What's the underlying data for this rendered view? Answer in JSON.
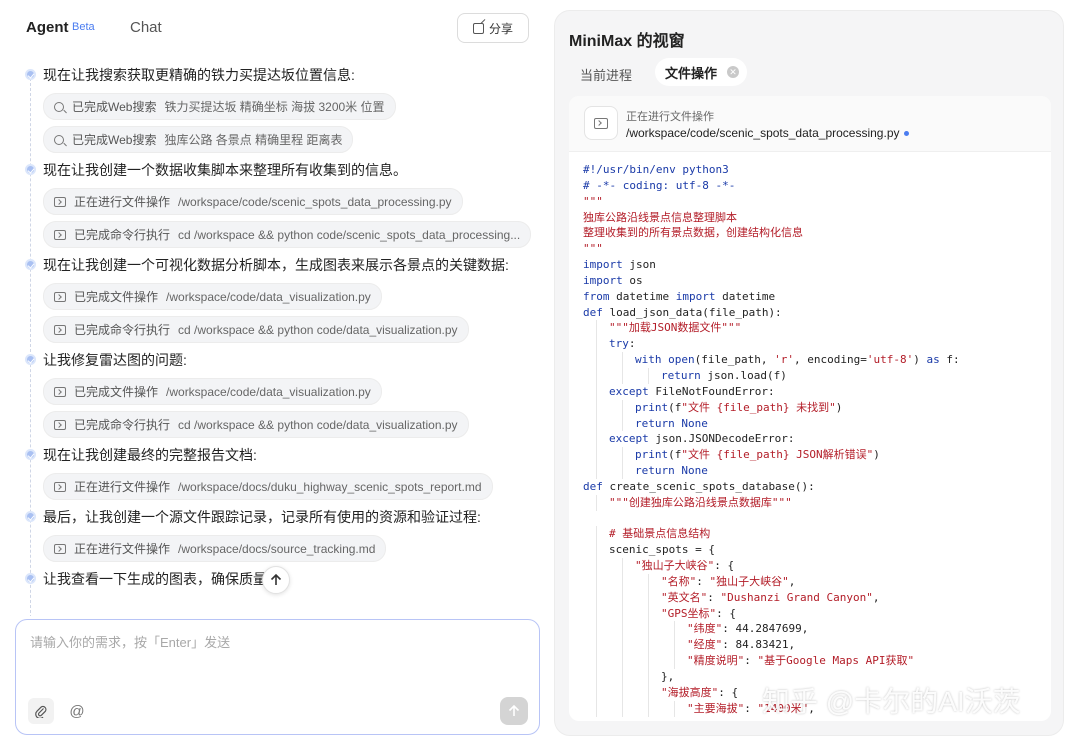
{
  "header": {
    "agent_tab": "Agent",
    "beta_badge": "Beta",
    "chat_tab": "Chat",
    "share_label": "分享"
  },
  "steps": [
    {
      "title": "现在让我搜索获取更精确的铁力买提达坂位置信息:",
      "chips": [
        {
          "icon": "search-icon",
          "status": "已完成Web搜索",
          "detail": "铁力买提达坂 精确坐标 海拔 3200米 位置"
        },
        {
          "icon": "search-icon",
          "status": "已完成Web搜索",
          "detail": "独库公路 各景点 精确里程 距离表"
        }
      ]
    },
    {
      "title": "现在让我创建一个数据收集脚本来整理所有收集到的信息。",
      "chips": [
        {
          "icon": "terminal-icon",
          "status": "正在进行文件操作",
          "detail": "/workspace/code/scenic_spots_data_processing.py"
        },
        {
          "icon": "terminal-icon",
          "status": "已完成命令行执行",
          "detail": "cd /workspace && python code/scenic_spots_data_processing..."
        }
      ]
    },
    {
      "title": "现在让我创建一个可视化数据分析脚本，生成图表来展示各景点的关键数据:",
      "chips": [
        {
          "icon": "terminal-icon",
          "status": "已完成文件操作",
          "detail": "/workspace/code/data_visualization.py"
        },
        {
          "icon": "terminal-icon",
          "status": "已完成命令行执行",
          "detail": "cd /workspace && python code/data_visualization.py"
        }
      ]
    },
    {
      "title": "让我修复雷达图的问题:",
      "chips": [
        {
          "icon": "terminal-icon",
          "status": "已完成文件操作",
          "detail": "/workspace/code/data_visualization.py"
        },
        {
          "icon": "terminal-icon",
          "status": "已完成命令行执行",
          "detail": "cd /workspace && python code/data_visualization.py"
        }
      ]
    },
    {
      "title": "现在让我创建最终的完整报告文档:",
      "chips": [
        {
          "icon": "terminal-icon",
          "status": "正在进行文件操作",
          "detail": "/workspace/docs/duku_highway_scenic_spots_report.md"
        }
      ]
    },
    {
      "title": "最后，让我创建一个源文件跟踪记录，记录所有使用的资源和验证过程:",
      "chips": [
        {
          "icon": "terminal-icon",
          "status": "正在进行文件操作",
          "detail": "/workspace/docs/source_tracking.md"
        }
      ]
    },
    {
      "title": "让我查看一下生成的图表，确保质量:",
      "chips": []
    }
  ],
  "input": {
    "placeholder": "请输入你的需求，按「Enter」发送",
    "value": ""
  },
  "right_panel": {
    "title": "MiniMax 的视窗",
    "tabs": [
      "当前进程",
      "文件操作"
    ],
    "active_tab": "文件操作",
    "file_status": "正在进行文件操作",
    "file_path": "/workspace/code/scenic_spots_data_processing.py",
    "code_lines": [
      {
        "indent": 0,
        "text": "#!/usr/bin/env python3"
      },
      {
        "indent": 0,
        "text": "# -*- coding: utf-8 -*-"
      },
      {
        "indent": 0,
        "text": "\"\"\""
      },
      {
        "indent": 0,
        "text": "独库公路沿线景点信息整理脚本"
      },
      {
        "indent": 0,
        "text": "整理收集到的所有景点数据，创建结构化信息"
      },
      {
        "indent": 0,
        "text": "\"\"\""
      },
      {
        "indent": 0,
        "text": "import json"
      },
      {
        "indent": 0,
        "text": "import os"
      },
      {
        "indent": 0,
        "text": "from datetime import datetime"
      },
      {
        "indent": 0,
        "text": "def load_json_data(file_path):"
      },
      {
        "indent": 1,
        "text": "\"\"\"加载JSON数据文件\"\"\""
      },
      {
        "indent": 1,
        "text": "try:"
      },
      {
        "indent": 2,
        "text": "with open(file_path, 'r', encoding='utf-8') as f:"
      },
      {
        "indent": 3,
        "text": "return json.load(f)"
      },
      {
        "indent": 1,
        "text": "except FileNotFoundError:"
      },
      {
        "indent": 2,
        "text": "print(f\"文件 {file_path} 未找到\")"
      },
      {
        "indent": 2,
        "text": "return None"
      },
      {
        "indent": 1,
        "text": "except json.JSONDecodeError:"
      },
      {
        "indent": 2,
        "text": "print(f\"文件 {file_path} JSON解析错误\")"
      },
      {
        "indent": 2,
        "text": "return None"
      },
      {
        "indent": 0,
        "text": "def create_scenic_spots_database():"
      },
      {
        "indent": 1,
        "text": "\"\"\"创建独库公路沿线景点数据库\"\"\""
      },
      {
        "indent": 0,
        "text": ""
      },
      {
        "indent": 1,
        "text": "# 基础景点信息结构"
      },
      {
        "indent": 1,
        "text": "scenic_spots = {"
      },
      {
        "indent": 2,
        "text": "\"独山子大峡谷\": {"
      },
      {
        "indent": 3,
        "text": "\"名称\": \"独山子大峡谷\","
      },
      {
        "indent": 3,
        "text": "\"英文名\": \"Dushanzi Grand Canyon\","
      },
      {
        "indent": 3,
        "text": "\"GPS坐标\": {"
      },
      {
        "indent": 4,
        "text": "\"纬度\": 44.2847699,"
      },
      {
        "indent": 4,
        "text": "\"经度\": 84.83421,"
      },
      {
        "indent": 4,
        "text": "\"精度说明\": \"基于Google Maps API获取\""
      },
      {
        "indent": 3,
        "text": "},"
      },
      {
        "indent": 3,
        "text": "\"海拔高度\": {"
      },
      {
        "indent": 4,
        "text": "\"主要海拔\": \"1400米\","
      }
    ]
  },
  "watermark": "知乎 @卡尔的AI沃茨",
  "colors": {
    "accent": "#4a7cf0",
    "keyword": "#1a3aa8",
    "string": "#b31d28",
    "comment": "#b31d28"
  }
}
